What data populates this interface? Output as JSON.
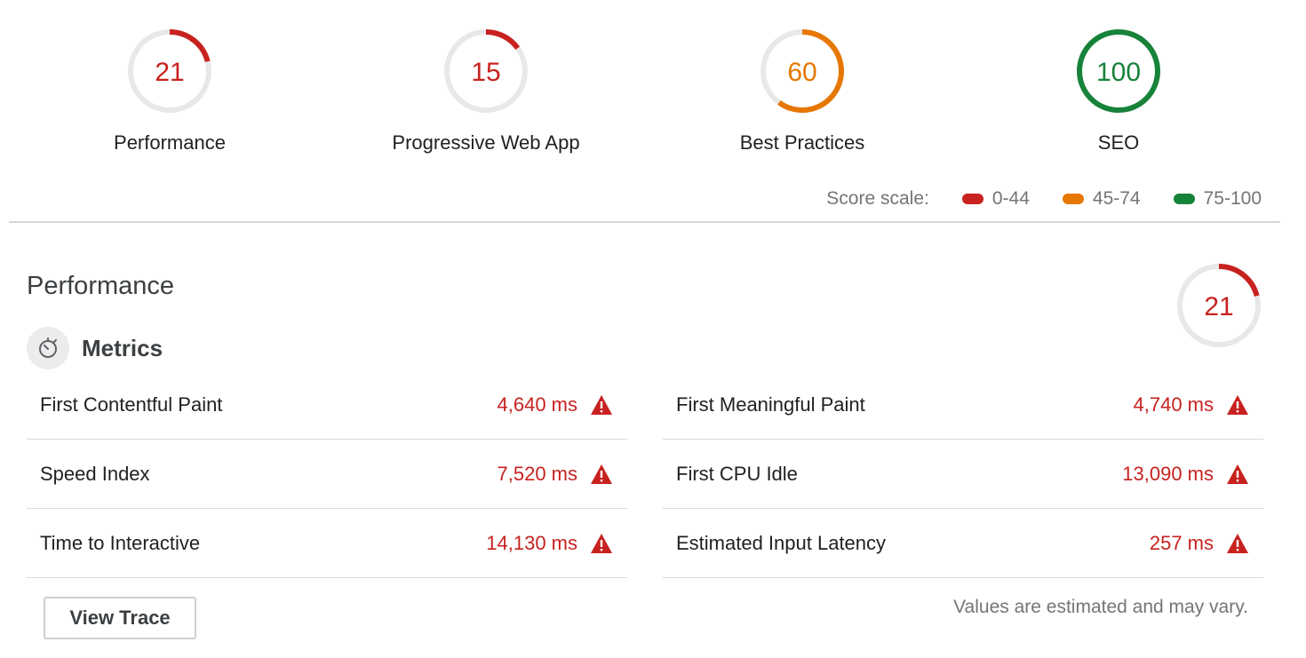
{
  "categories": [
    {
      "score": "21",
      "fraction": 0.21,
      "label": "Performance",
      "color": "#c7221f"
    },
    {
      "score": "15",
      "fraction": 0.15,
      "label": "Progressive Web App",
      "color": "#c7221f"
    },
    {
      "score": "60",
      "fraction": 0.6,
      "label": "Best Practices",
      "color": "#e67700"
    },
    {
      "score": "100",
      "fraction": 1.0,
      "label": "SEO",
      "color": "#178239"
    }
  ],
  "scale": {
    "label": "Score scale:",
    "ranges": [
      {
        "text": "0-44",
        "color": "#c7221f"
      },
      {
        "text": "45-74",
        "color": "#e67700"
      },
      {
        "text": "75-100",
        "color": "#178239"
      }
    ]
  },
  "performance": {
    "title": "Performance",
    "score": "21",
    "fraction": 0.21,
    "color": "#c7221f",
    "metrics_title": "Metrics",
    "metrics": [
      {
        "name": "First Contentful Paint",
        "value": "4,640 ms"
      },
      {
        "name": "First Meaningful Paint",
        "value": "4,740 ms"
      },
      {
        "name": "Speed Index",
        "value": "7,520 ms"
      },
      {
        "name": "First CPU Idle",
        "value": "13,090 ms"
      },
      {
        "name": "Time to Interactive",
        "value": "14,130 ms"
      },
      {
        "name": "Estimated Input Latency",
        "value": "257 ms"
      }
    ],
    "view_trace_label": "View Trace",
    "note": "Values are estimated and may vary."
  },
  "icons": {
    "metrics": "stopwatch-icon",
    "warning": "warning-triangle-icon"
  }
}
